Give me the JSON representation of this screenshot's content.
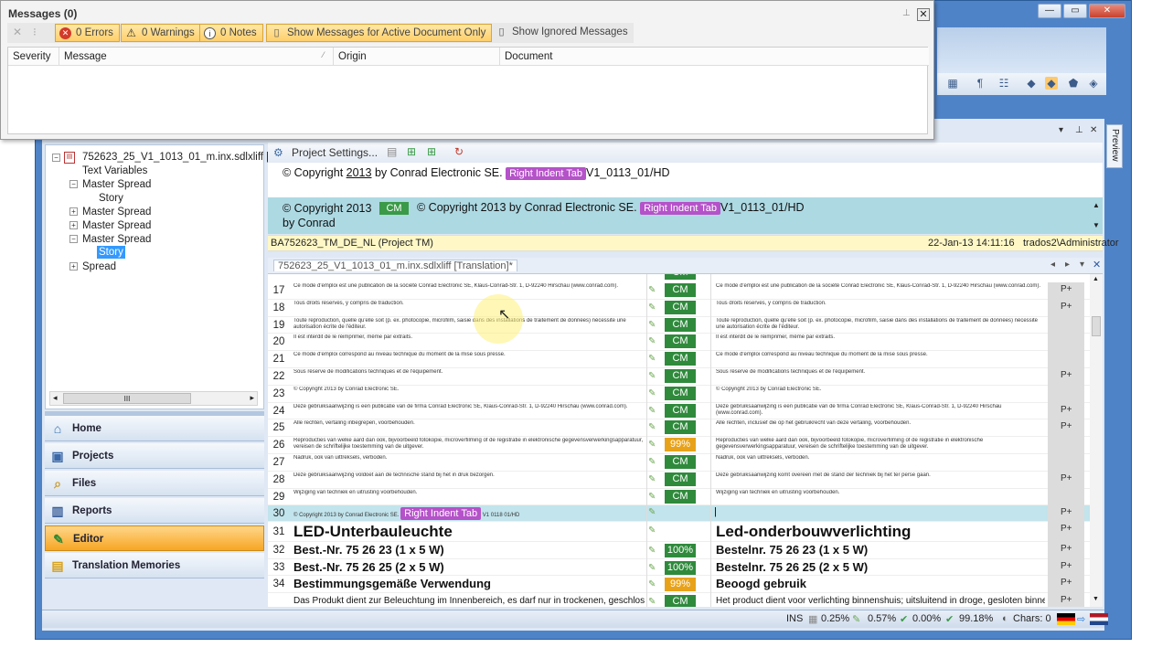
{
  "window_controls": [
    "—",
    "▭",
    "✕"
  ],
  "messages": {
    "title": "Messages (0)",
    "buttons": {
      "errors": "0 Errors",
      "warnings": "0 Warnings",
      "notes": "0 Notes",
      "active_only": "Show Messages for Active Document Only",
      "ignored": "Show Ignored Messages"
    },
    "columns": [
      "Severity",
      "Message",
      "Origin",
      "Document"
    ]
  },
  "tree": {
    "file": "752623_25_V1_1013_01_m.inx.sdlxliff [",
    "items": [
      "Text Variables",
      "Master Spread",
      "Story",
      "Master Spread",
      "Master Spread",
      "Master Spread",
      "Story",
      "Spread"
    ],
    "scroll_grip": "III"
  },
  "nav": [
    "Home",
    "Projects",
    "Files",
    "Reports",
    "Editor",
    "Translation Memories"
  ],
  "preview_tab": "Preview",
  "project_toolbar": {
    "label": "Project Settings..."
  },
  "source_preview": {
    "pre": "© Copyright ",
    "year": "2013",
    "post": " by Conrad Electronic SE.",
    "tag": "Right Indent Tab",
    "tail": "V1_0113_01/HD"
  },
  "tm_pane": {
    "left_text": "© Copyright 2013 by Conrad",
    "match": "CM",
    "text": "© Copyright 2013 by Conrad Electronic SE.",
    "tag": "Right Indent Tab",
    "tail": "V1_0113_01/HD"
  },
  "tm_status": {
    "tm": "BA752623_TM_DE_NL (Project TM)",
    "date": "22-Jan-13 14:11:16",
    "user": "trados2\\Administrator"
  },
  "doc_tab": "752623_25_V1_1013_01_m.inx.sdlxliff [Translation]*",
  "rows": [
    {
      "n": "17",
      "src": "Ce mode d'emploi est une publication de la société Conrad Electronic SE, Klaus-Conrad-Str. 1, D-92240 Hirschau (www.conrad.com).",
      "st": "CM",
      "tgt": "Ce mode d'emploi est une publication de la société Conrad Electronic SE, Klaus-Conrad-Str. 1, D-92240 Hirschau (www.conrad.com).",
      "p": "P+"
    },
    {
      "n": "18",
      "src": "Tous droits réservés, y compris de traduction.",
      "st": "CM",
      "tgt": "Tous droits réservés, y compris de traduction.",
      "p": "P+"
    },
    {
      "n": "19",
      "src": "Toute reproduction, quelle qu'elle soit (p. ex. photocopie, microfilm, saisie dans des installations de traitement de données) nécessite une autorisation écrite de l'éditeur.",
      "st": "CM",
      "tgt": "Toute reproduction, quelle qu'elle soit (p. ex. photocopie, microfilm, saisie dans des installations de traitement de données) nécessite une autorisation écrite de l'éditeur.",
      "p": ""
    },
    {
      "n": "20",
      "src": "Il est interdit de le réimprimer, même par extraits.",
      "st": "CM",
      "tgt": "Il est interdit de le réimprimer, même par extraits.",
      "p": ""
    },
    {
      "n": "21",
      "src": "Ce mode d'emploi correspond au niveau technique du moment de la mise sous presse.",
      "st": "CM",
      "tgt": "Ce mode d'emploi correspond au niveau technique du moment de la mise sous presse.",
      "p": ""
    },
    {
      "n": "22",
      "src": "Sous réserve de modifications techniques et de l'équipement.",
      "st": "CM",
      "tgt": "Sous réserve de modifications techniques et de l'équipement.",
      "p": "P+"
    },
    {
      "n": "23",
      "src": "© Copyright 2013 by Conrad Electronic SE.",
      "st": "CM",
      "tgt": "© Copyright 2013 by Conrad Electronic SE.",
      "p": ""
    },
    {
      "n": "24",
      "src": "Deze gebruiksaanwijzing is een publicatie van de firma Conrad Electronic SE, Klaus-Conrad-Str. 1, D-92240 Hirschau (www.conrad.com).",
      "st": "CM",
      "tgt": "Deze gebruiksaanwijzing is een publicatie van de firma Conrad Electronic SE, Klaus-Conrad-Str. 1, D-92240 Hirschau (www.conrad.com).",
      "p": "P+"
    },
    {
      "n": "25",
      "src": "Alle rechten, vertaling inbegrepen, voorbehouden.",
      "st": "CM",
      "tgt": "Alle rechten, inclusief die op het gebruikrecht van deze vertaling, voorbehouden.",
      "p": "P+"
    },
    {
      "n": "26",
      "src": "Reproducties van welke aard dan ook, bijvoorbeeld fotokopie, microverfilming of de registratie in elektronische gegevensverwerkingsapparatuur, vereisen de schriftelijke toestemming van de uitgever.",
      "st": "99%",
      "tgt": "Reproducties van welke aard dan ook, bijvoorbeeld fotokopie, microverfilming of de registratie in elektronische gegevensverwerkingsapparatuur, vereisen de schriftelijke toestemming van de uitgever.",
      "p": ""
    },
    {
      "n": "27",
      "src": "Nadruk, ook van uittreksels, verboden.",
      "st": "CM",
      "tgt": "Nadruk, ook van uittreksels, verboden.",
      "p": ""
    },
    {
      "n": "28",
      "src": "Deze gebruiksaanwijzing voldoet aan de technische stand bij het in druk bezorgen.",
      "st": "CM",
      "tgt": "Deze gebruiksaanwijzing komt overeen met de stand der techniek bij het ter perse gaan.",
      "p": "P+"
    },
    {
      "n": "29",
      "src": "Wijziging van techniek en uitrusting voorbehouden.",
      "st": "CM",
      "tgt": "Wijziging van techniek en uitrusting voorbehouden.",
      "p": ""
    }
  ],
  "row30": {
    "n": "30",
    "src": "© Copyright 2013 by Conrad Electronic SE.",
    "tag": "Right Indent Tab",
    "tail": "V1 0118 01/HD",
    "p": "P+"
  },
  "big_rows": [
    {
      "n": "31",
      "src": "LED-Unterbauleuchte",
      "st": "",
      "tgt": "Led-onderbouwverlichting",
      "p": "P+"
    },
    {
      "n": "32",
      "src": "Best.-Nr. 75 26 23 (1 x 5 W)",
      "st": "100%",
      "tgt": "Bestelnr. 75 26 23 (1 x 5 W)",
      "p": "P+"
    },
    {
      "n": "33",
      "src": "Best.-Nr. 75 26 25 (2 x 5 W)",
      "st": "100%",
      "tgt": "Bestelnr. 75 26 25 (2 x 5 W)",
      "p": "P+"
    },
    {
      "n": "34",
      "src": "Bestimmungsgemäße Verwendung",
      "st": "99%",
      "tgt": "Beoogd gebruik",
      "p": "P+"
    },
    {
      "n": "",
      "src": "Das Produkt dient zur Beleuchtung im Innenbereich, es darf nur in trockenen, geschlossenen",
      "st": "CM",
      "tgt": "Het product dient voor verlichting binnenshuis; uitsluitend in droge, gesloten binnenruimtes",
      "p": "P+"
    }
  ],
  "statusbar": {
    "ins": "INS",
    "p1": "0.25%",
    "p2": "0.57%",
    "p3": "0.00%",
    "p4": "99.18%",
    "chars": "Chars: 0"
  }
}
